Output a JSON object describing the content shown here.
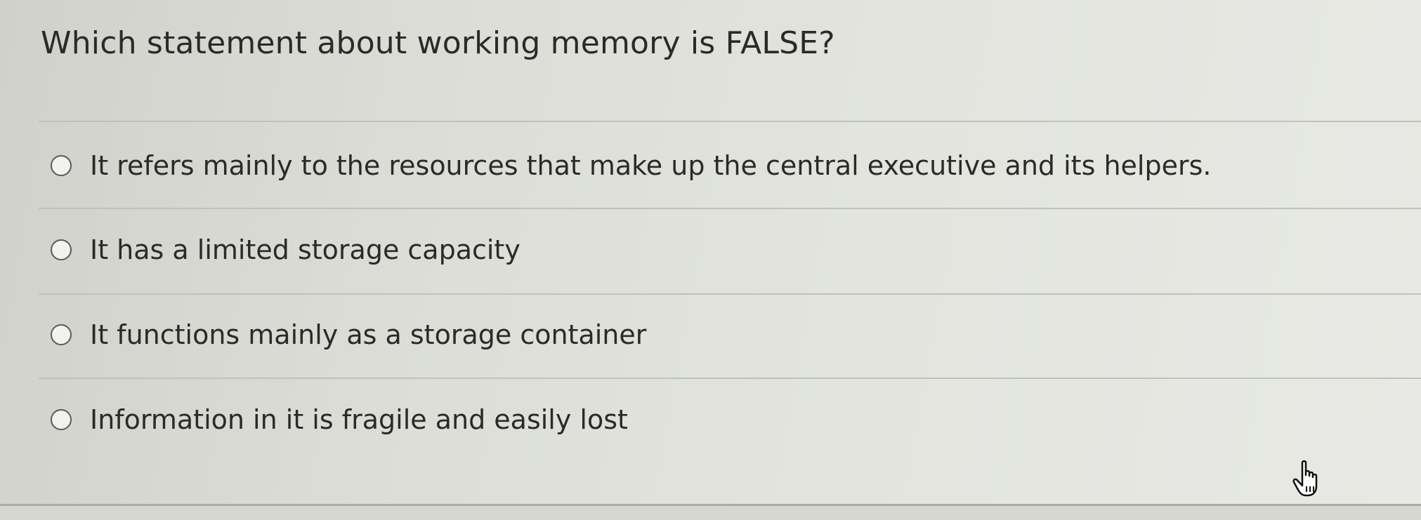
{
  "question": {
    "text": "Which statement about working memory is FALSE?"
  },
  "options": [
    {
      "label": "It refers mainly to the resources that make up the central executive and its helpers.",
      "selected": false
    },
    {
      "label": "It has a limited storage capacity",
      "selected": false
    },
    {
      "label": "It functions mainly as a storage container",
      "selected": false
    },
    {
      "label": "Information in it is fragile and easily lost",
      "selected": false
    }
  ],
  "cursor": {
    "icon": "hand-pointer-icon"
  },
  "colors": {
    "background": "#dfe0da",
    "text": "#2a2a2a",
    "divider": "#bfc2bb",
    "radio_border": "#5a5a5a"
  }
}
